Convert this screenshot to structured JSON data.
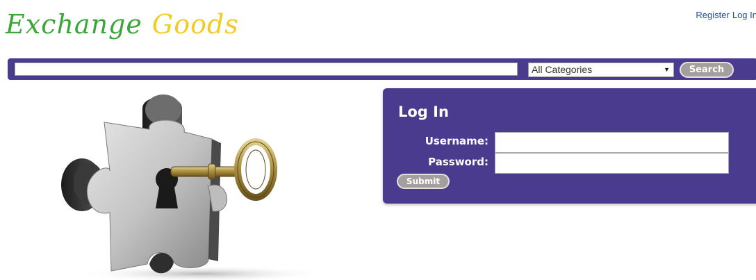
{
  "header": {
    "logo_word1": "Exchange",
    "logo_word2": "Goods",
    "links": {
      "register": "Register",
      "login": "Log In"
    }
  },
  "search": {
    "query": "",
    "category_selected": "All Categories",
    "button_label": "Search"
  },
  "login_form": {
    "title": "Log In",
    "username_label": "Username:",
    "username_value": "",
    "password_label": "Password:",
    "password_value": "",
    "submit_label": "Submit"
  },
  "hero": {
    "image_description": "puzzle-piece-with-key"
  },
  "colors": {
    "brand_purple": "#4b3b8f",
    "logo_green": "#3aa63a",
    "logo_yellow": "#f2cc23",
    "link_blue": "#1f4e9b",
    "button_gray": "#a59e9e"
  }
}
